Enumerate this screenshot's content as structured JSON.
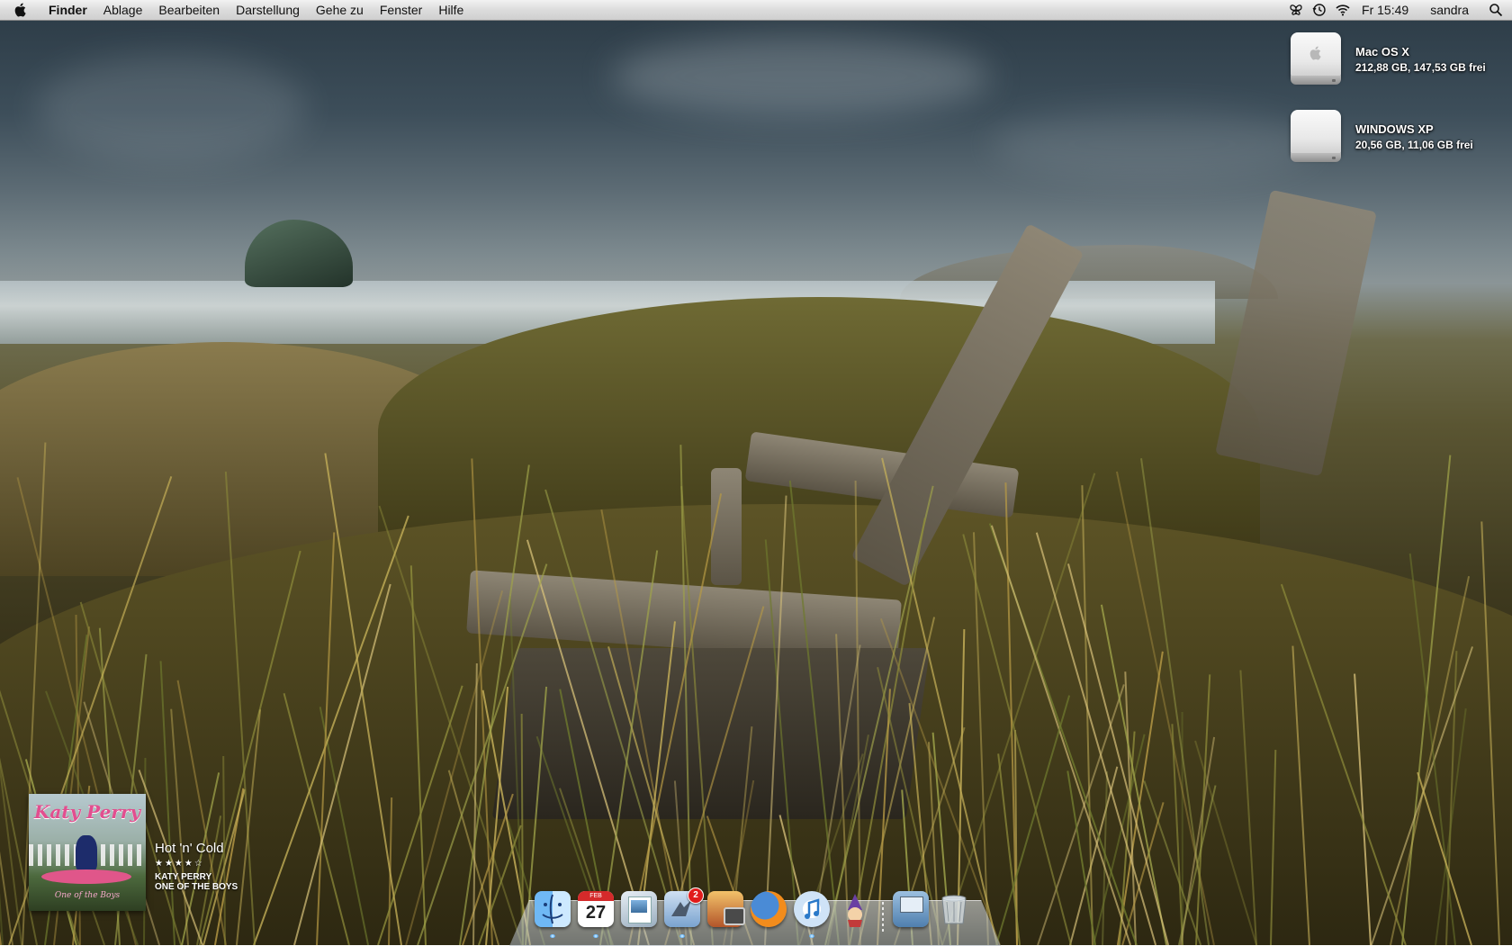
{
  "menubar": {
    "app_name": "Finder",
    "menus": [
      "Ablage",
      "Bearbeiten",
      "Darstellung",
      "Gehe zu",
      "Fenster",
      "Hilfe"
    ],
    "status_icons": [
      "butterfly-icon",
      "time-machine-icon",
      "wifi-icon"
    ],
    "clock": "Fr 15:49",
    "user": "sandra",
    "spotlight_icon": "spotlight-icon"
  },
  "desktop": {
    "volumes": [
      {
        "name": "Mac OS X",
        "info": "212,88 GB, 147,53 GB frei"
      },
      {
        "name": "WINDOWS XP",
        "info": "20,56 GB, 11,06 GB frei"
      }
    ]
  },
  "now_playing": {
    "album_artist_logo": "Katy Perry",
    "album_cover_title": "One of the Boys",
    "song": "Hot 'n' Cold",
    "rating": "★★★★☆",
    "artist": "KATY PERRY",
    "album": "ONE OF THE BOYS"
  },
  "dock": {
    "apps": [
      {
        "name": "finder",
        "icon": "finder-icon",
        "running": true
      },
      {
        "name": "ical",
        "icon": "calendar-icon",
        "month": "FEB",
        "day": "27",
        "running": true
      },
      {
        "name": "preview",
        "icon": "preview-icon",
        "running": false
      },
      {
        "name": "mail",
        "icon": "mail-icon",
        "badge": "2",
        "running": true
      },
      {
        "name": "iphoto",
        "icon": "iphoto-icon",
        "running": false
      },
      {
        "name": "firefox",
        "icon": "firefox-icon",
        "running": false
      },
      {
        "name": "itunes",
        "icon": "itunes-icon",
        "running": true
      },
      {
        "name": "wizard",
        "icon": "wizard-icon",
        "running": false
      }
    ],
    "stack": "applications-stack-icon",
    "trash": "trash-icon",
    "colors": {
      "running_indicator": "#64b6ff",
      "badge": "#e11b1b"
    }
  }
}
